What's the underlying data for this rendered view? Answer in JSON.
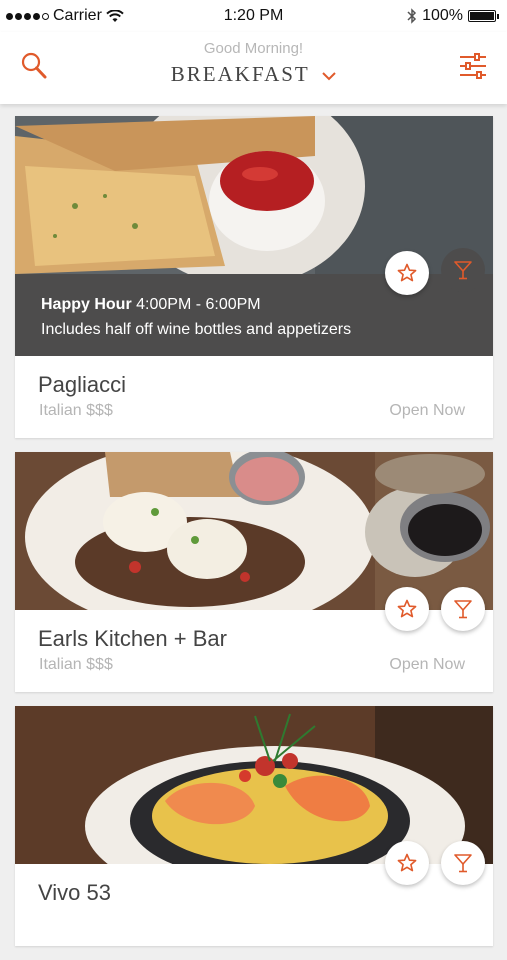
{
  "status_bar": {
    "carrier": "Carrier",
    "time": "1:20 PM",
    "battery": "100%"
  },
  "header": {
    "greeting": "Good Morning!",
    "meal": "BREAKFAST",
    "icons": {
      "left": "search-icon",
      "right": "filter-sliders-icon"
    },
    "accent_color": "#e05a2b"
  },
  "restaurants": [
    {
      "name": "Pagliacci",
      "meta": "Italian $$$",
      "status": "Open Now",
      "happy_hour": {
        "label": "Happy Hour",
        "hours": "4:00PM - 6:00PM",
        "details": "Includes half off wine bottles and appetizers"
      }
    },
    {
      "name": "Earls Kitchen + Bar",
      "meta": "Italian $$$",
      "status": "Open Now"
    },
    {
      "name": "Vivo 53"
    }
  ]
}
